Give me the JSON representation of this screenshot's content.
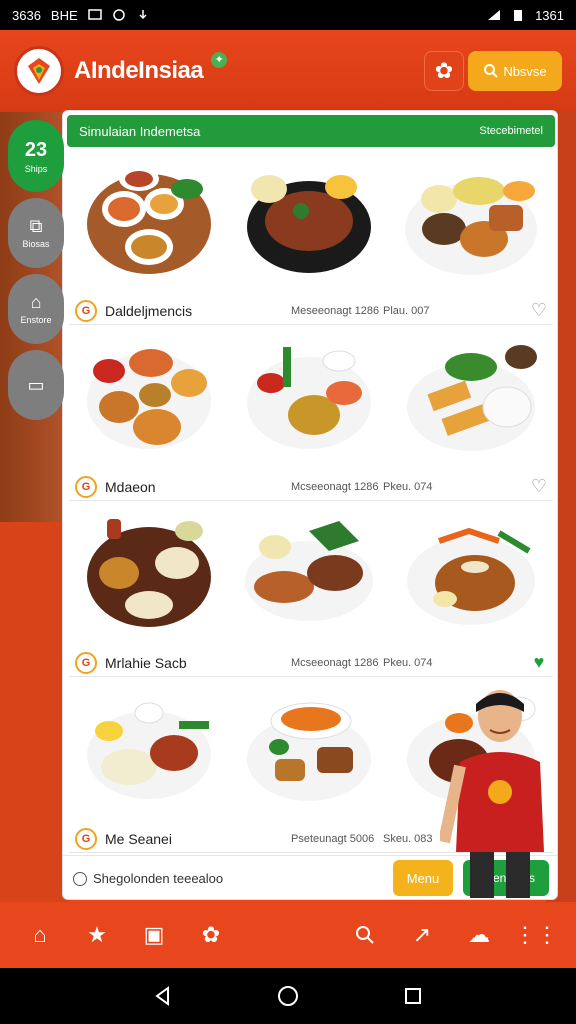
{
  "status_bar": {
    "left_text": "3636",
    "carrier": "BHE",
    "time": "1361"
  },
  "header": {
    "app_title": "AIndeInsiaa",
    "search_label": "Nbsvse"
  },
  "side_nav": {
    "badge_count": "23",
    "badge_label": "Ships",
    "items": [
      {
        "label": "Biosas",
        "icon": "chat-icon"
      },
      {
        "label": "Enstore",
        "icon": "home-icon"
      },
      {
        "label": "",
        "icon": "book-icon"
      }
    ]
  },
  "panel": {
    "header_title": "Simulaian Indemetsa",
    "header_right": "Stecebimetel"
  },
  "cards": [
    {
      "name": "Daldeljmencis",
      "meta": "Meseeonagt 1286",
      "sub": "Plau. 007",
      "favorite": false
    },
    {
      "name": "Mdaeon",
      "meta": "Mcseeonagt 1286",
      "sub": "Pkeu. 074",
      "favorite": false
    },
    {
      "name": "Mrlahie Sacb",
      "meta": "Mcseeonagt 1286",
      "sub": "Pkeu. 074",
      "favorite": true
    },
    {
      "name": "Me Seanei",
      "meta": "Pseteunagt 5006",
      "sub": "Skeu. 083",
      "favorite": false
    }
  ],
  "bottom_panel": {
    "search_hint": "Shegolonden teeealoo",
    "menu_label": "Menu",
    "greet_label": "Ghenenels"
  },
  "colors": {
    "primary": "#e8461c",
    "accent_green": "#1e9e3c",
    "accent_yellow": "#f4a91c"
  }
}
